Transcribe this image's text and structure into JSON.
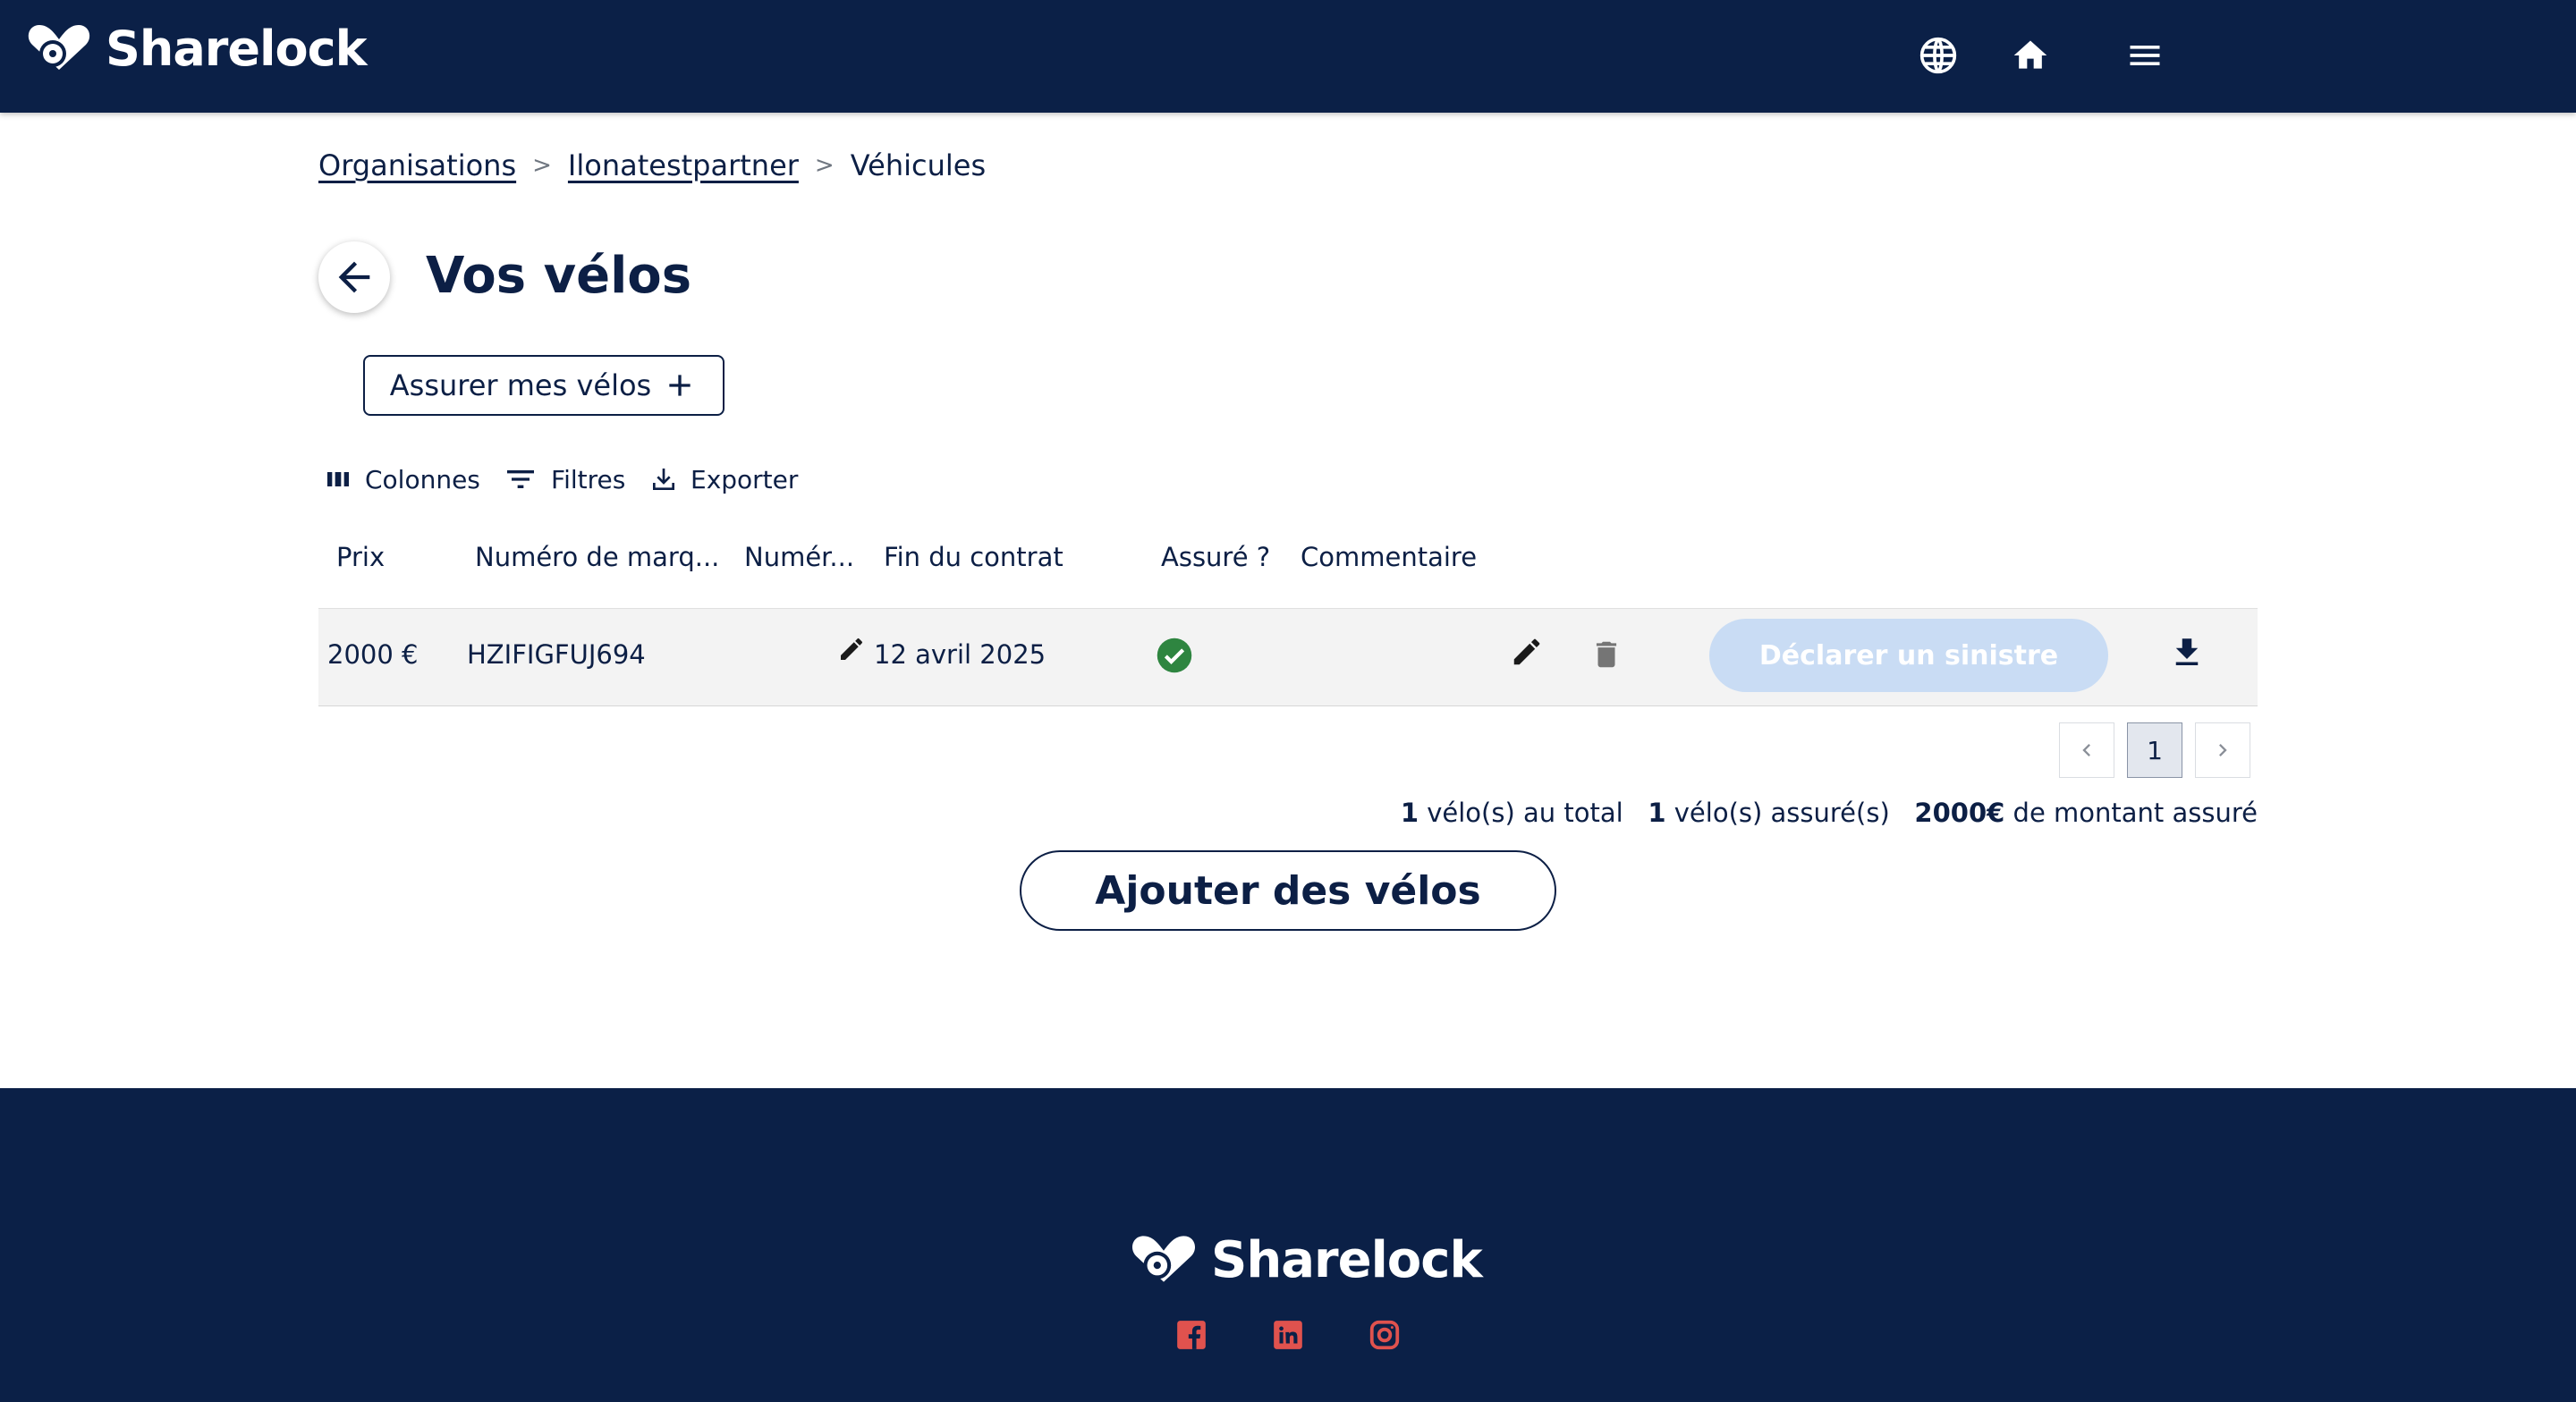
{
  "header": {
    "brand": "Sharelock",
    "icons": [
      "globe-icon",
      "home-icon",
      "menu-icon"
    ]
  },
  "breadcrumb": {
    "items": [
      "Organisations",
      "Ilonatestpartner",
      "Véhicules"
    ],
    "separator": ">"
  },
  "page": {
    "title": "Vos vélos",
    "insure_label": "Assurer mes vélos"
  },
  "toolbar": {
    "columns": "Colonnes",
    "filters": "Filtres",
    "export": "Exporter"
  },
  "table": {
    "headers": [
      "Prix",
      "Numéro de marq...",
      "Numér...",
      "Fin du contrat",
      "Assuré ?",
      "Commentaire"
    ],
    "rows": [
      {
        "price": "2000 €",
        "marking": "HZIFIGFUJ694",
        "end_date": "12 avril 2025",
        "insured": true,
        "comment": "",
        "claim_label": "Déclarer un sinistre"
      }
    ]
  },
  "pagination": {
    "current": "1",
    "prev_icon": "chevron-left-icon",
    "next_icon": "chevron-right-icon"
  },
  "summary": {
    "total_count": "1",
    "total_label": "vélo(s) au total",
    "insured_count": "1",
    "insured_label": "vélo(s) assuré(s)",
    "amount": "2000€",
    "amount_label": "de montant assuré"
  },
  "add_label": "Ajouter des vélos",
  "footer": {
    "brand": "Sharelock",
    "social": [
      "facebook-icon",
      "linkedin-icon",
      "instagram-icon"
    ]
  },
  "colors": {
    "navy": "#0b2047",
    "accent_red": "#e0524e",
    "success_green": "#2e8540",
    "disabled_blue": "#c9dcf4"
  }
}
